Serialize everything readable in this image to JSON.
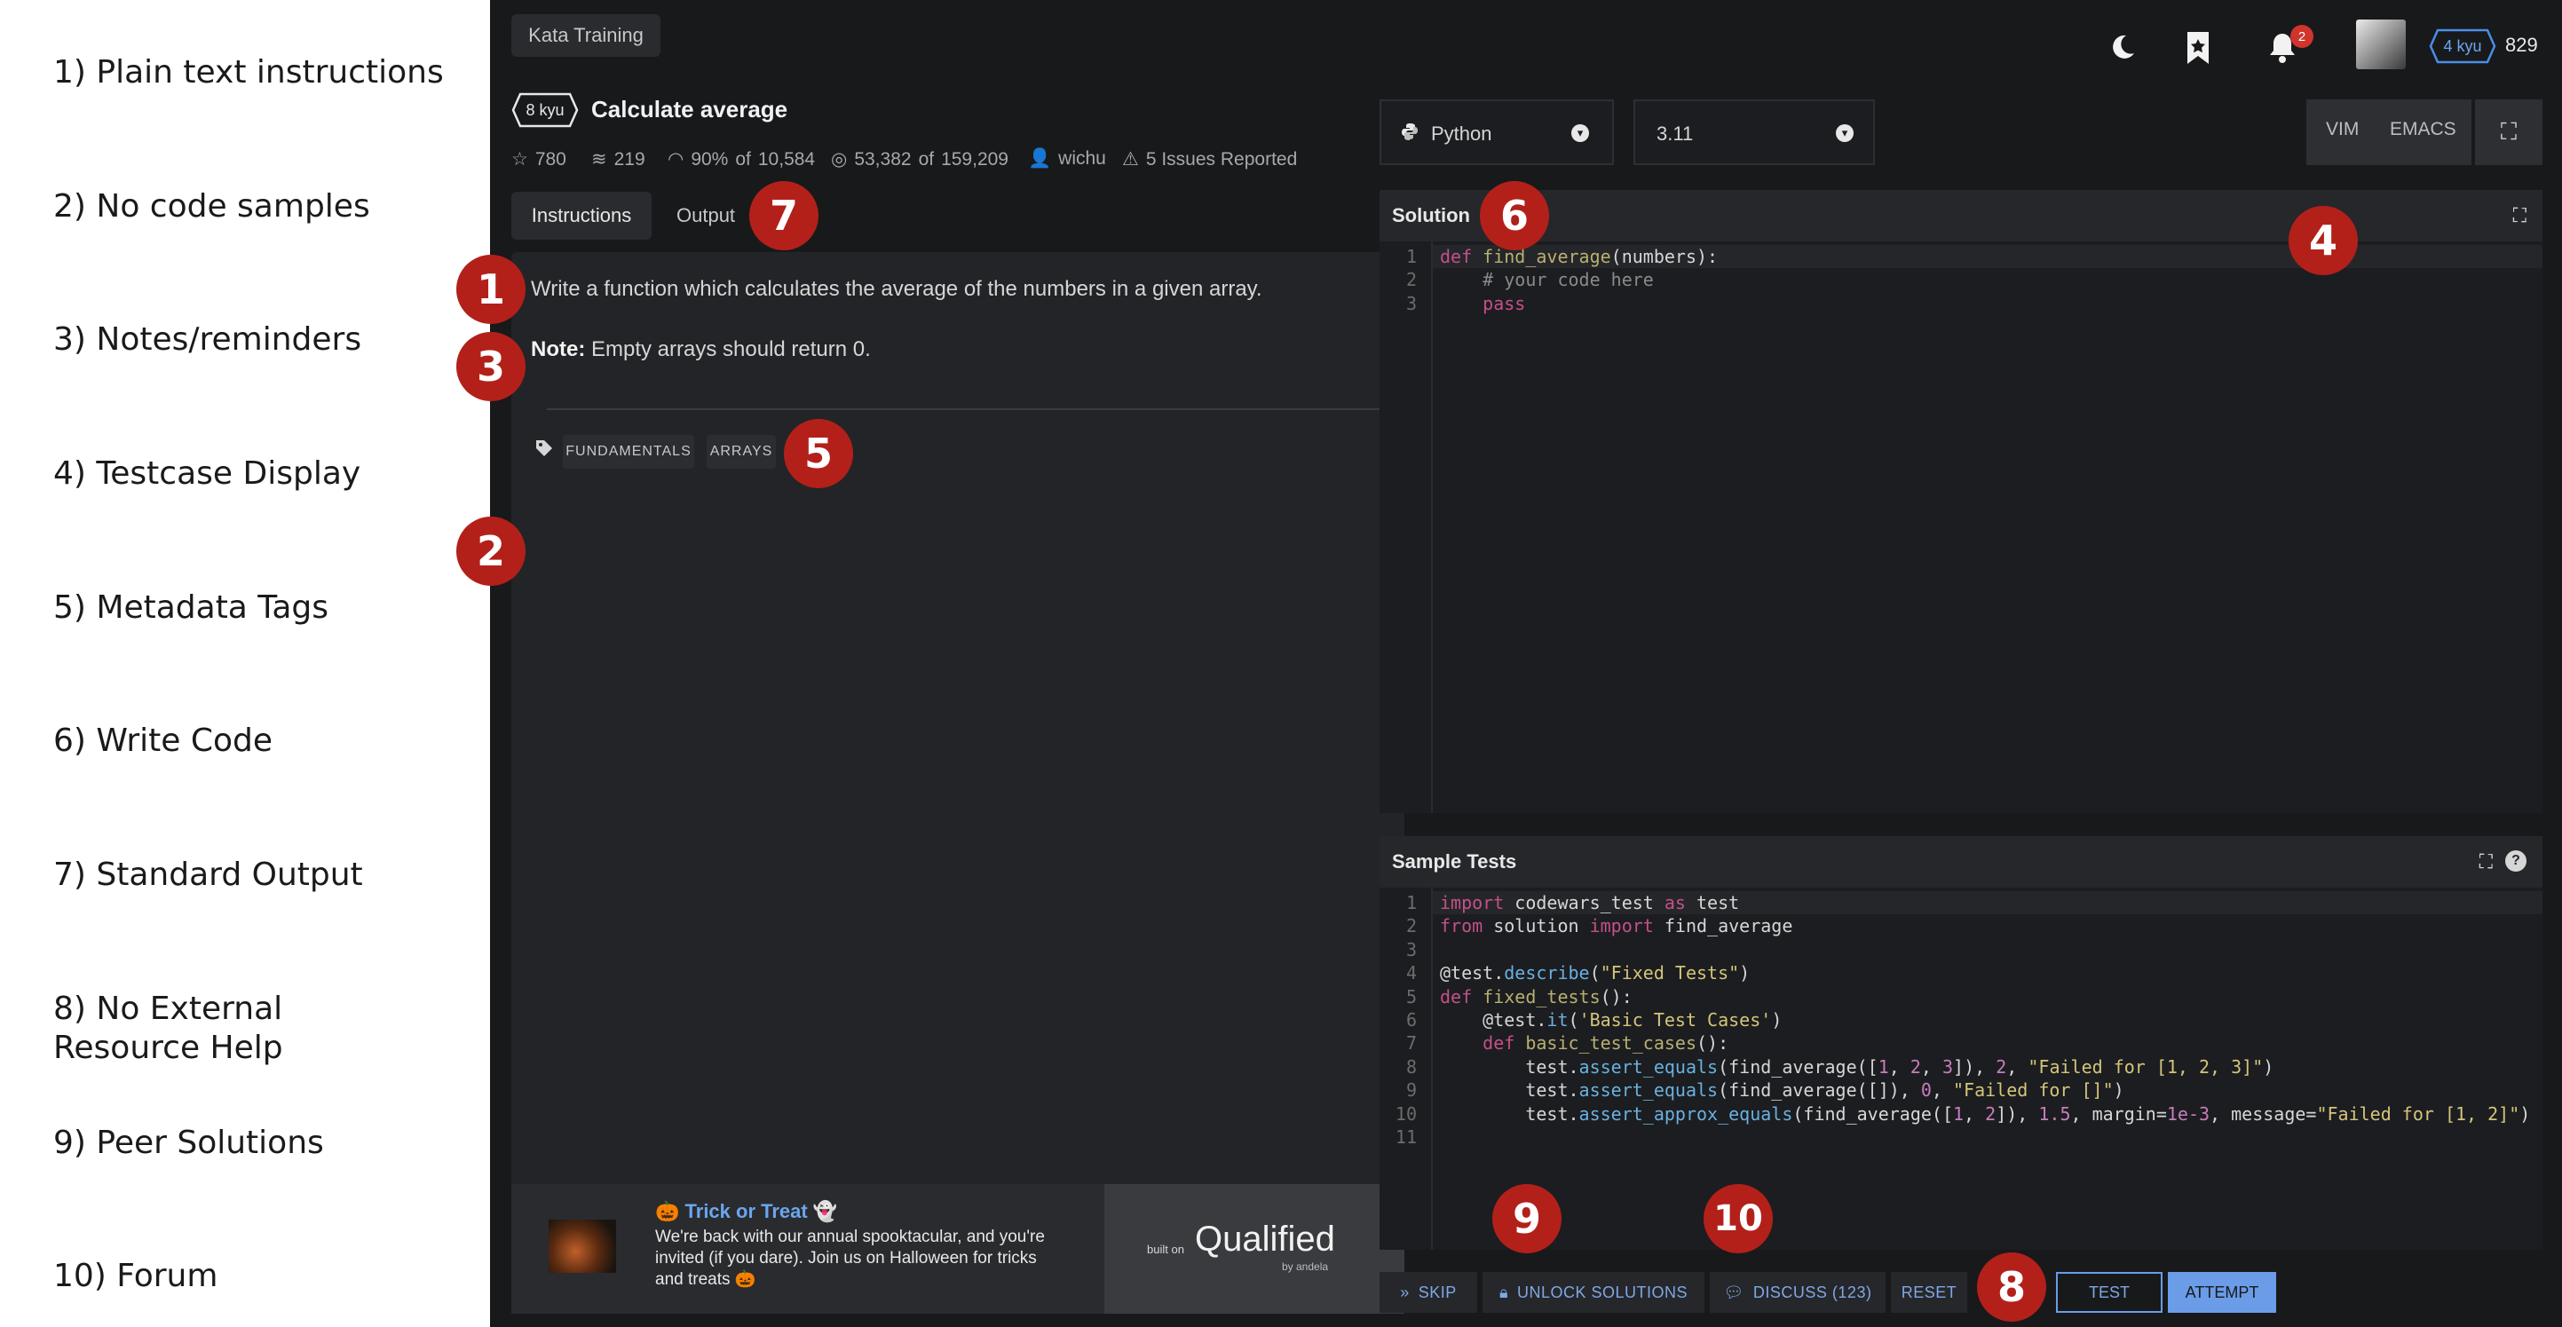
{
  "legend": [
    "1) Plain text instructions",
    "2) No code samples",
    "3) Notes/reminders",
    "4) Testcase Display",
    "5) Metadata Tags",
    "6) Write Code",
    "7) Standard Output",
    "8) No External\nResource Help",
    "9) Peer Solutions",
    "10) Forum"
  ],
  "topbar": {
    "section": "Kata Training",
    "notifications_count": "2",
    "user_rank": "4 kyu",
    "honor": "829"
  },
  "kata": {
    "rank": "8 kyu",
    "title": "Calculate average",
    "stars": "780",
    "collections": "219",
    "satisfaction_pct": "90%",
    "satisfaction_of": "of",
    "satisfaction_total": "10,584",
    "completed": "53,382",
    "completed_of": "of",
    "attempted": "159,209",
    "author": "wichu",
    "issues": "5 Issues Reported"
  },
  "tabs": {
    "instructions": "Instructions",
    "output": "Output"
  },
  "description": {
    "text": "Write a function which calculates the average of the numbers in a given array.",
    "note_label": "Note:",
    "note_text": " Empty arrays should return 0."
  },
  "tags": [
    "FUNDAMENTALS",
    "ARRAYS"
  ],
  "promo": {
    "title": "Trick or Treat",
    "body": "We're back with our annual spooktacular, and you're invited (if you dare). Join us on Halloween for tricks and treats",
    "built_on": "built on",
    "brand": "Qualified",
    "brand_sub": "by andela"
  },
  "language": {
    "name": "Python",
    "version": "3.11"
  },
  "modes": {
    "vim": "VIM",
    "emacs": "EMACS"
  },
  "solution_editor": {
    "title": "Solution"
  },
  "tests_editor": {
    "title": "Sample Tests"
  },
  "badges": [
    "1",
    "2",
    "3",
    "4",
    "5",
    "6",
    "7",
    "8",
    "9",
    "10"
  ],
  "actions": {
    "skip": "SKIP",
    "unlock": "UNLOCK SOLUTIONS",
    "discuss": "DISCUSS (123)",
    "reset": "RESET",
    "test": "TEST",
    "attempt": "ATTEMPT"
  },
  "colors": {
    "badge_red": "#b3201a",
    "accent_blue": "#6a9ce8",
    "bg_dark": "#18191b"
  }
}
